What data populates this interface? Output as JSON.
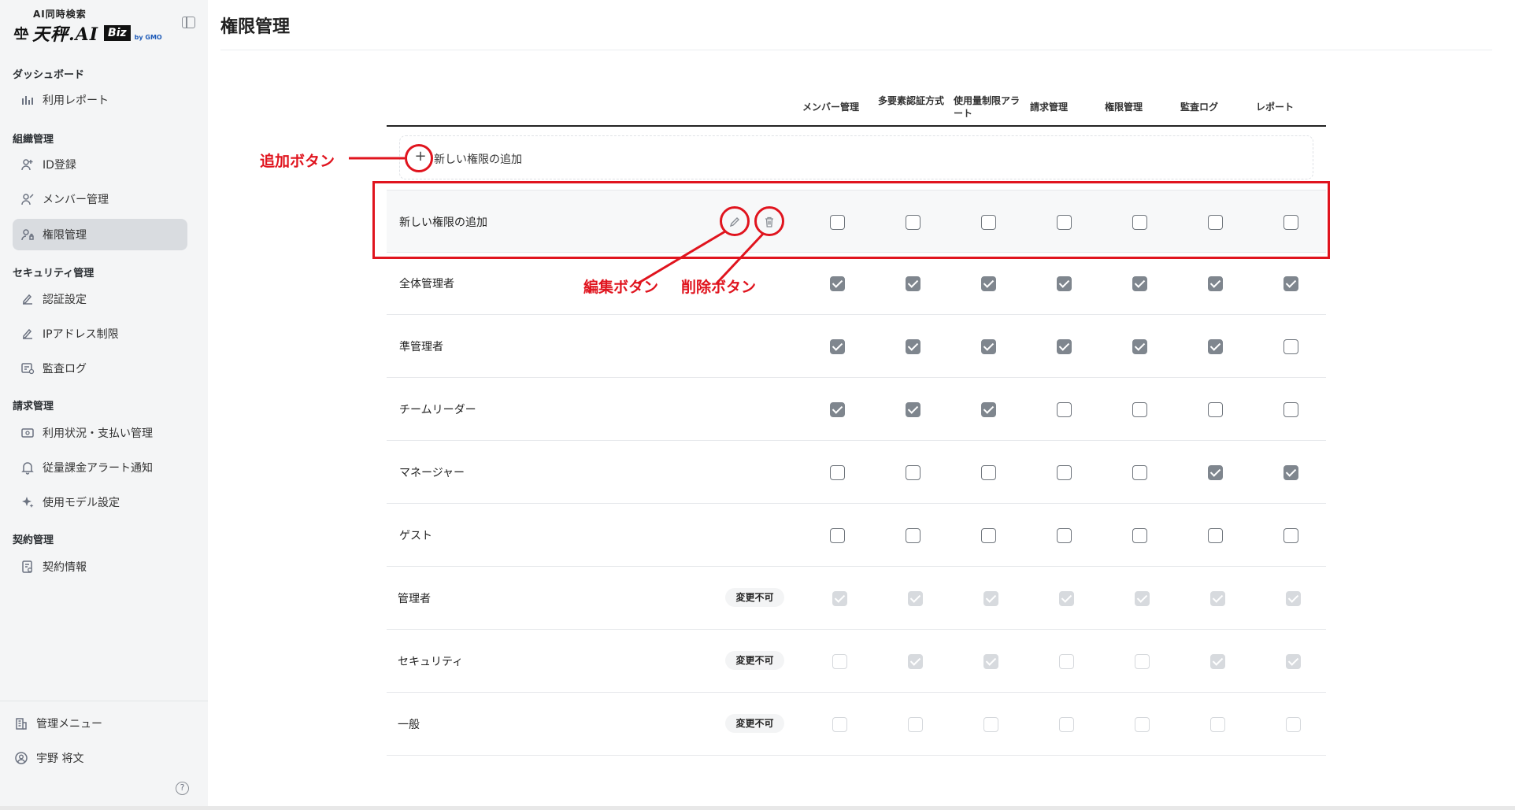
{
  "app": {
    "logo_sub": "AI同時検索",
    "logo_main": "天秤.AI",
    "logo_badge": "Biz",
    "logo_by": "by GMO"
  },
  "sidebar": {
    "sections": [
      {
        "title": "ダッシュボード",
        "items": [
          {
            "label": "利用レポート",
            "icon": "bar-chart-icon"
          }
        ]
      },
      {
        "title": "組織管理",
        "items": [
          {
            "label": "ID登録",
            "icon": "user-plus-icon"
          },
          {
            "label": "メンバー管理",
            "icon": "user-edit-icon"
          },
          {
            "label": "権限管理",
            "icon": "user-lock-icon",
            "active": true
          }
        ]
      },
      {
        "title": "セキュリティ管理",
        "items": [
          {
            "label": "認証設定",
            "icon": "signature-icon"
          },
          {
            "label": "IPアドレス制限",
            "icon": "signature-icon"
          },
          {
            "label": "監査ログ",
            "icon": "log-icon"
          }
        ]
      },
      {
        "title": "請求管理",
        "items": [
          {
            "label": "利用状況・支払い管理",
            "icon": "money-icon"
          },
          {
            "label": "従量課金アラート通知",
            "icon": "bell-icon"
          },
          {
            "label": "使用モデル設定",
            "icon": "sparkle-icon"
          }
        ]
      },
      {
        "title": "契約管理",
        "items": [
          {
            "label": "契約情報",
            "icon": "contract-icon"
          }
        ]
      }
    ],
    "footer": {
      "admin_menu": "管理メニュー",
      "user_name": "宇野 将文"
    }
  },
  "page": {
    "title": "権限管理"
  },
  "table": {
    "columns": [
      "メンバー管理",
      "多要素認証方式",
      "使用量制限アラート",
      "請求管理",
      "権限管理",
      "監査ログ",
      "レポート"
    ],
    "add_row_label": "新しい権限の追加",
    "lock_label": "変更不可",
    "rows": [
      {
        "name": "新しい権限の追加",
        "editable": true,
        "locked": false,
        "values": [
          0,
          0,
          0,
          0,
          0,
          0,
          0
        ]
      },
      {
        "name": "全体管理者",
        "locked": false,
        "values": [
          1,
          1,
          1,
          1,
          1,
          1,
          1
        ]
      },
      {
        "name": "準管理者",
        "locked": false,
        "values": [
          1,
          1,
          1,
          1,
          1,
          1,
          0
        ]
      },
      {
        "name": "チームリーダー",
        "locked": false,
        "values": [
          1,
          1,
          1,
          0,
          0,
          0,
          0
        ]
      },
      {
        "name": "マネージャー",
        "locked": false,
        "values": [
          0,
          0,
          0,
          0,
          0,
          1,
          1
        ]
      },
      {
        "name": "ゲスト",
        "locked": false,
        "values": [
          0,
          0,
          0,
          0,
          0,
          0,
          0
        ]
      },
      {
        "name": "管理者",
        "locked": true,
        "values": [
          1,
          1,
          1,
          1,
          1,
          1,
          1
        ]
      },
      {
        "name": "セキュリティ",
        "locked": true,
        "values": [
          0,
          1,
          1,
          0,
          0,
          1,
          1
        ]
      },
      {
        "name": "一般",
        "locked": true,
        "values": [
          0,
          0,
          0,
          0,
          0,
          0,
          0
        ]
      }
    ]
  },
  "annotations": {
    "add_button": "追加ボタン",
    "edit_button": "編集ボタン",
    "delete_button": "削除ボタン",
    "color": "#e0141e"
  }
}
